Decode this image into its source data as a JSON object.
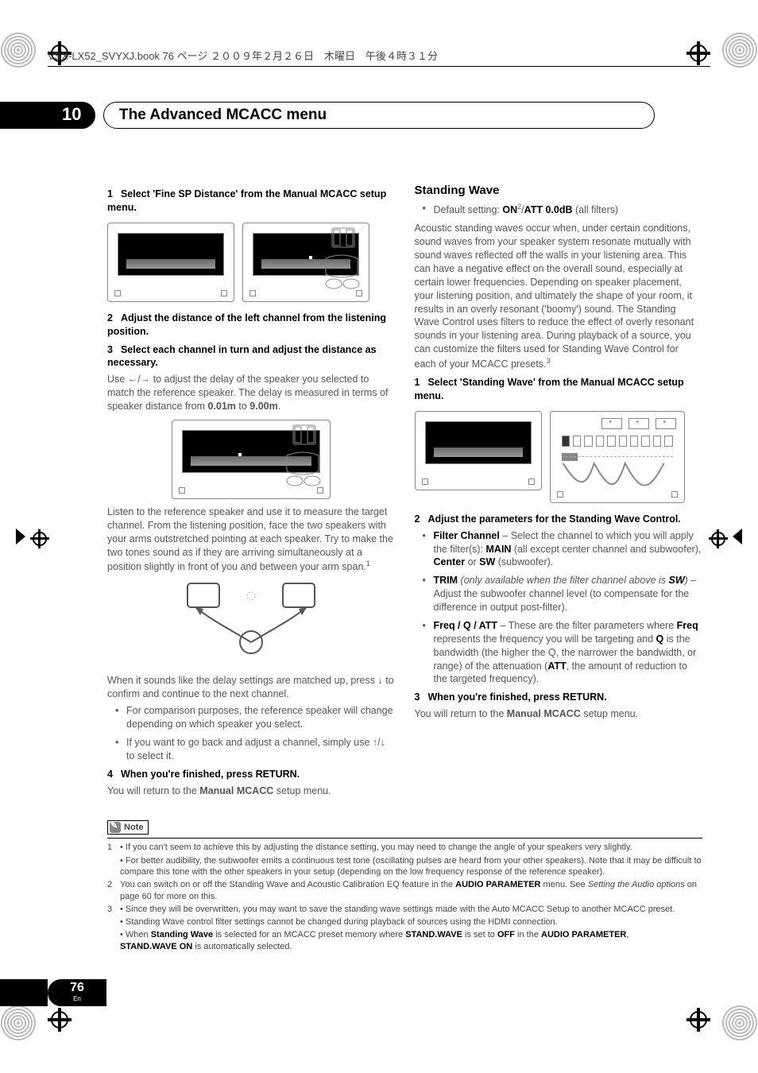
{
  "header_tag": "VSX-LX52_SVYXJ.book  76 ページ  ２００９年２月２６日　木曜日　午後４時３１分",
  "chapter": {
    "number": "10",
    "title": "The Advanced MCACC menu"
  },
  "left": {
    "step1": {
      "n": "1",
      "title": "Select 'Fine SP Distance' from the Manual MCACC setup menu."
    },
    "step2": {
      "n": "2",
      "title": "Adjust the distance of the left channel from the listening position."
    },
    "step3": {
      "n": "3",
      "title": "Select each channel in turn and adjust the distance as necessary."
    },
    "step3_body_a": "Use ",
    "step3_body_arrows": "←/→",
    "step3_body_b": " to adjust the delay of the speaker you selected to match the reference speaker. The delay is measured in terms of speaker distance from ",
    "dist_from": "0.01m",
    "dist_to_word": " to ",
    "dist_to": "9.00m",
    "listen_para": "Listen to the reference speaker and use it to measure the target channel. From the listening position, face the two speakers with your arms outstretched pointing at each speaker. Try to make the two tones sound as if they are arriving simultaneously at a position slightly in front of you and between your arm span.",
    "listen_sup": "1",
    "match_para_a": "When it sounds like the delay settings are matched up, press ",
    "match_arrow": "↓",
    "match_para_b": " to confirm and continue to the next channel.",
    "bul1": "For comparison purposes, the reference speaker will change depending on which speaker you select.",
    "bul2_a": "If you want to go back and adjust a channel, simply use ",
    "bul2_arrows": "↑/↓",
    "bul2_b": " to select it.",
    "step4": {
      "n": "4",
      "title": "When you're finished, press RETURN."
    },
    "return_line_a": "You will return to the ",
    "return_line_b": "Manual MCACC",
    "return_line_c": " setup menu."
  },
  "right": {
    "heading": "Standing Wave",
    "default_a": "Default setting: ",
    "default_on": "ON",
    "default_sup": "2",
    "default_sep": "/",
    "default_att": "ATT 0.0dB",
    "default_tail": " (all filters)",
    "para": "Acoustic standing waves occur when, under certain conditions, sound waves from your speaker system resonate mutually with sound waves reflected off the walls in your listening area. This can have a negative effect on the overall sound, especially at certain lower frequencies. Depending on speaker placement, your listening position, and ultimately the shape of your room, it results in an overly resonant ('boomy') sound. The Standing Wave Control uses filters to reduce the effect of overly resonant sounds in your listening area. During playback of a source, you can customize the filters used for Standing Wave Control for each of your MCACC presets.",
    "para_sup": "3",
    "step1": {
      "n": "1",
      "title": "Select 'Standing Wave' from the Manual MCACC setup menu."
    },
    "step2": {
      "n": "2",
      "title": "Adjust the parameters for the Standing Wave Control."
    },
    "b1_label": "Filter Channel",
    "b1_body_a": " – Select the channel to which you will apply the filter(s): ",
    "b1_main": "MAIN",
    "b1_body_b": " (all except center channel and subwoofer), ",
    "b1_center": "Center",
    "b1_body_c": " or ",
    "b1_sw": "SW",
    "b1_body_d": " (subwoofer).",
    "b2_label": "TRIM",
    "b2_it": " (only available when the filter channel above is ",
    "b2_sw": "SW",
    "b2_it_end": ")",
    "b2_body": " – Adjust the subwoofer channel level (to compensate for the difference in output post-filter).",
    "b3_label": "Freq / Q / ATT",
    "b3_body_a": " – These are the filter parameters where ",
    "b3_freq": "Freq",
    "b3_body_b": " represents the frequency you will be targeting and ",
    "b3_q": "Q",
    "b3_body_c": " is the bandwidth (the higher the Q, the narrower the bandwidth, or range) of the attenuation (",
    "b3_att": "ATT",
    "b3_body_d": ", the amount of reduction to the targeted frequency).",
    "step3": {
      "n": "3",
      "title": "When you're finished, press RETURN."
    },
    "return_line_a": "You will return to the ",
    "return_line_b": "Manual MCACC",
    "return_line_c": " setup menu."
  },
  "note": {
    "label": "Note",
    "fn1_n": "1",
    "fn1_a": "• If you can't seem to achieve this by adjusting the distance setting, you may need to change the angle of your speakers very slightly.",
    "fn1_b": "• For better audibility, the subwoofer emits a continuous test tone (oscillating pulses are heard from your other speakers). Note that it may be difficult to compare this tone with the other speakers in your setup (depending on the low frequency response of the reference speaker).",
    "fn2_n": "2",
    "fn2_a_a": "You can switch on or off the Standing Wave and Acoustic Calibration EQ feature in the ",
    "fn2_a_b": "AUDIO PARAMETER",
    "fn2_a_c": " menu. See ",
    "fn2_a_it": "Setting the Audio options",
    "fn2_a_d": " on page 60 for more on this.",
    "fn3_n": "3",
    "fn3_a": "• Since they will be overwritten, you may want to save the standing wave settings made with the Auto MCACC Setup to another MCACC preset.",
    "fn3_b": "• Standing Wave control filter settings cannot be changed during playback of sources using the HDMI connection.",
    "fn3_c_a": "• When ",
    "fn3_c_b": "Standing Wave",
    "fn3_c_c": " is selected for an MCACC preset memory where ",
    "fn3_c_d": "STAND.WAVE",
    "fn3_c_e": " is set to ",
    "fn3_c_f": "OFF",
    "fn3_c_g": " in the ",
    "fn3_c_h": "AUDIO PARAMETER",
    "fn3_c_i": ", ",
    "fn3_c_j": "STAND.WAVE ON",
    "fn3_c_k": " is automatically selected."
  },
  "page_number": "76",
  "page_lang": "En"
}
